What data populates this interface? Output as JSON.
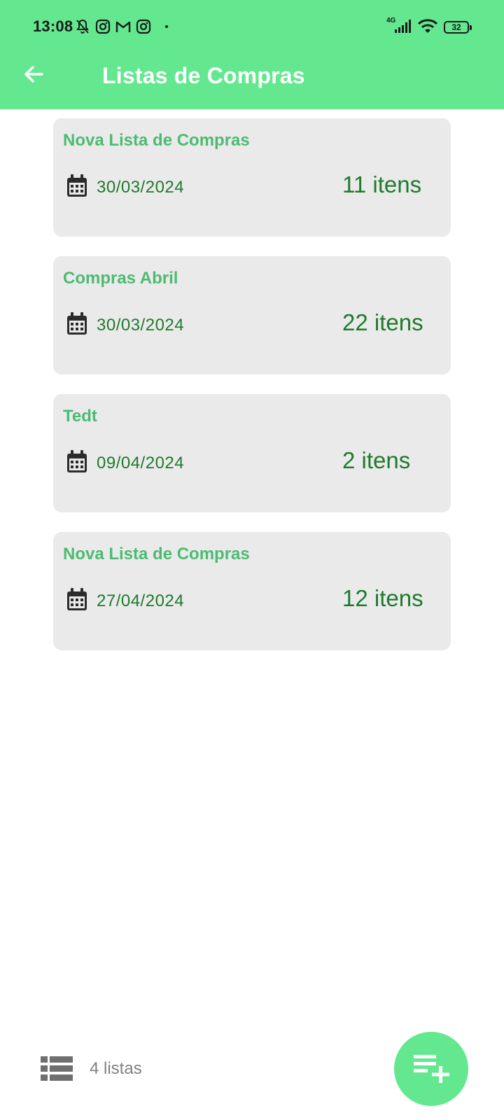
{
  "status_bar": {
    "time": "13:08",
    "network": "4G",
    "battery": "32",
    "icons": [
      "notifications-off-icon",
      "instagram-icon",
      "gmail-icon",
      "instagram-icon",
      "signal-icon",
      "wifi-icon",
      "battery-icon"
    ]
  },
  "header": {
    "title": "Listas de Compras",
    "back_icon": "arrow-back-icon",
    "background": "#63E88F"
  },
  "lists": [
    {
      "name": "Nova Lista de Compras",
      "date": "30/03/2024",
      "items": "11 itens"
    },
    {
      "name": "Compras Abril",
      "date": "30/03/2024",
      "items": "22 itens"
    },
    {
      "name": "Tedt",
      "date": "09/04/2024",
      "items": "2 itens"
    },
    {
      "name": "Nova Lista de Compras",
      "date": "27/04/2024",
      "items": "12 itens"
    }
  ],
  "footer": {
    "count_label": "4 listas",
    "list_icon": "list-view-icon",
    "fab_icon": "playlist-add-icon"
  },
  "colors": {
    "accent": "#63E88F",
    "title_green": "#4CBB72",
    "value_green": "#1F7A2C",
    "card_bg": "#EAEAEA",
    "muted": "#808080"
  }
}
